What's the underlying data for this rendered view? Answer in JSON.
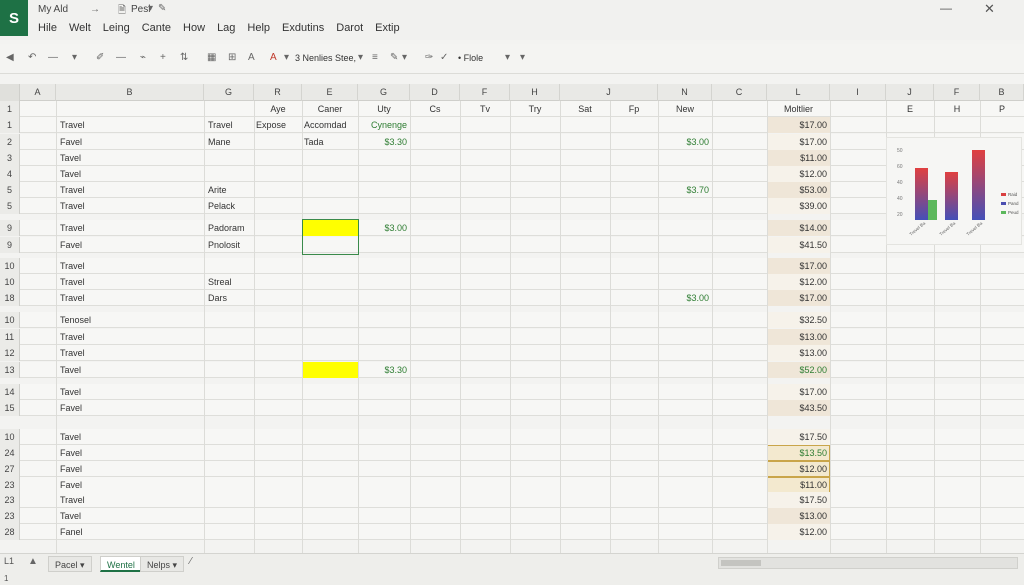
{
  "app": {
    "logo": "S",
    "file_title": "My Ald",
    "arrow": "→",
    "doc_name": "Pesl",
    "doc_caret": "▾"
  },
  "menu": [
    "Hile",
    "Welt",
    "Leing",
    "Cante",
    "How",
    "Lag",
    "Help",
    "Exdutins",
    "Darot",
    "Extip"
  ],
  "toolbar": {
    "font_name": "3 Nenlies Stee,",
    "style_name": "• Flole"
  },
  "columns": [
    "A",
    "B",
    "G",
    "R",
    "E",
    "G",
    "D",
    "F",
    "H",
    "J",
    "N",
    "C",
    "L",
    "I",
    "J",
    "F",
    "B"
  ],
  "header_row": {
    "num": "1",
    "cells": {
      "R": "Aye",
      "E": "Caner",
      "G": "Uty",
      "D": "Cs",
      "F": "Tv",
      "H": "Try",
      "J": "Sat",
      "J2": "Fp",
      "N": "New",
      "L": "Moltlier",
      "J3": "E",
      "F2": "H",
      "B2": "P"
    }
  },
  "rows": [
    {
      "num": "1",
      "b": "Travel",
      "g": "Travel",
      "r": "Expose",
      "e": "Accomdad",
      "gv": "Cynenge",
      "n": "",
      "l": "$17.00"
    },
    {
      "num": "2",
      "b": "Favel",
      "g": "Mane",
      "r": "",
      "e": "Tada",
      "gv": "$3.30",
      "n": "$3.00",
      "l": "$17.00"
    },
    {
      "num": "3",
      "b": "Tavel",
      "g": "",
      "r": "",
      "e": "",
      "gv": "",
      "n": "",
      "l": "$11.00"
    },
    {
      "num": "4",
      "b": "Tavel",
      "g": "",
      "r": "",
      "e": "",
      "gv": "",
      "n": "",
      "l": "$12.00"
    },
    {
      "num": "5",
      "b": "Travel",
      "g": "Arite",
      "r": "",
      "e": "",
      "gv": "",
      "n": "$3.70",
      "l": "$53.00"
    },
    {
      "num": "5",
      "b": "Travel",
      "g": "Pelack",
      "r": "",
      "e": "",
      "gv": "",
      "n": "",
      "l": "$39.00"
    },
    {
      "num": "9",
      "b": "Travel",
      "g": "Padoram",
      "r": "",
      "e": "",
      "gv": "$3.00",
      "n": "",
      "l": "$14.00"
    },
    {
      "num": "9",
      "b": "Favel",
      "g": "Pnolosit",
      "r": "",
      "e": "",
      "gv": "",
      "n": "",
      "l": "$41.50"
    },
    {
      "num": "10",
      "b": "Travel",
      "g": "",
      "r": "",
      "e": "",
      "gv": "",
      "n": "",
      "l": "$17.00"
    },
    {
      "num": "10",
      "b": "Travel",
      "g": "Streal",
      "r": "",
      "e": "",
      "gv": "",
      "n": "",
      "l": "$12.00"
    },
    {
      "num": "18",
      "b": "Travel",
      "g": "Dars",
      "r": "",
      "e": "",
      "gv": "",
      "n": "$3.00",
      "l": "$17.00"
    },
    {
      "num": "10",
      "b": "Tenosel",
      "g": "",
      "r": "",
      "e": "",
      "gv": "",
      "n": "",
      "l": "$32.50"
    },
    {
      "num": "11",
      "b": "Travel",
      "g": "",
      "r": "",
      "e": "",
      "gv": "",
      "n": "",
      "l": "$13.00"
    },
    {
      "num": "12",
      "b": "Travel",
      "g": "",
      "r": "",
      "e": "",
      "gv": "",
      "n": "",
      "l": "$13.00"
    },
    {
      "num": "13",
      "b": "Tavel",
      "g": "",
      "r": "",
      "e": "",
      "gv": "$3.30",
      "n": "",
      "l": "$52.00"
    },
    {
      "num": "14",
      "b": "Tavel",
      "g": "",
      "r": "",
      "e": "",
      "gv": "",
      "n": "",
      "l": "$17.00"
    },
    {
      "num": "15",
      "b": "Favel",
      "g": "",
      "r": "",
      "e": "",
      "gv": "",
      "n": "",
      "l": "$43.50"
    },
    {
      "num": "10",
      "b": "Tavel",
      "g": "",
      "r": "",
      "e": "",
      "gv": "",
      "n": "",
      "l": "$17.50"
    },
    {
      "num": "24",
      "b": "Favel",
      "g": "",
      "r": "",
      "e": "",
      "gv": "",
      "n": "",
      "l": "$13.50"
    },
    {
      "num": "27",
      "b": "Favel",
      "g": "",
      "r": "",
      "e": "",
      "gv": "",
      "n": "",
      "l": "$12.00"
    },
    {
      "num": "23",
      "b": "Favel",
      "g": "",
      "r": "",
      "e": "",
      "gv": "",
      "n": "",
      "l": "$11.00"
    },
    {
      "num": "23",
      "b": "Travel",
      "g": "",
      "r": "",
      "e": "",
      "gv": "",
      "n": "",
      "l": "$17.50"
    },
    {
      "num": "23",
      "b": "Tavel",
      "g": "",
      "r": "",
      "e": "",
      "gv": "",
      "n": "",
      "l": "$13.00"
    },
    {
      "num": "28",
      "b": "Fanel",
      "g": "",
      "r": "",
      "e": "",
      "gv": "",
      "n": "",
      "l": "$12.00"
    }
  ],
  "chart": {
    "y_ticks": [
      "50",
      "60",
      "40",
      "40",
      "20"
    ],
    "legend": [
      {
        "label": "Raid",
        "color": "#d94040"
      },
      {
        "label": "Pand",
        "color": "#4b4fb0"
      },
      {
        "label": "Peud",
        "color": "#5cb85c"
      }
    ],
    "x_categories": [
      "Trevel Ba",
      "Trevel Ba",
      "Trevel Ba"
    ],
    "colors": {
      "red": "#e04040",
      "blue": "#4450b8",
      "green": "#5cb85c"
    }
  },
  "chart_data": {
    "type": "bar",
    "categories": [
      "Trevel Ba",
      "Trevel Ba",
      "Trevel Ba"
    ],
    "series": [
      {
        "name": "Raid",
        "values": [
          52,
          48,
          70
        ]
      },
      {
        "name": "Peud",
        "values": [
          20,
          0,
          0
        ]
      }
    ],
    "ylim": [
      0,
      70
    ]
  },
  "sheets": [
    "Pacel",
    "Wentel",
    "Nelps"
  ],
  "status": {
    "left": "L1",
    "bottom": "1"
  }
}
